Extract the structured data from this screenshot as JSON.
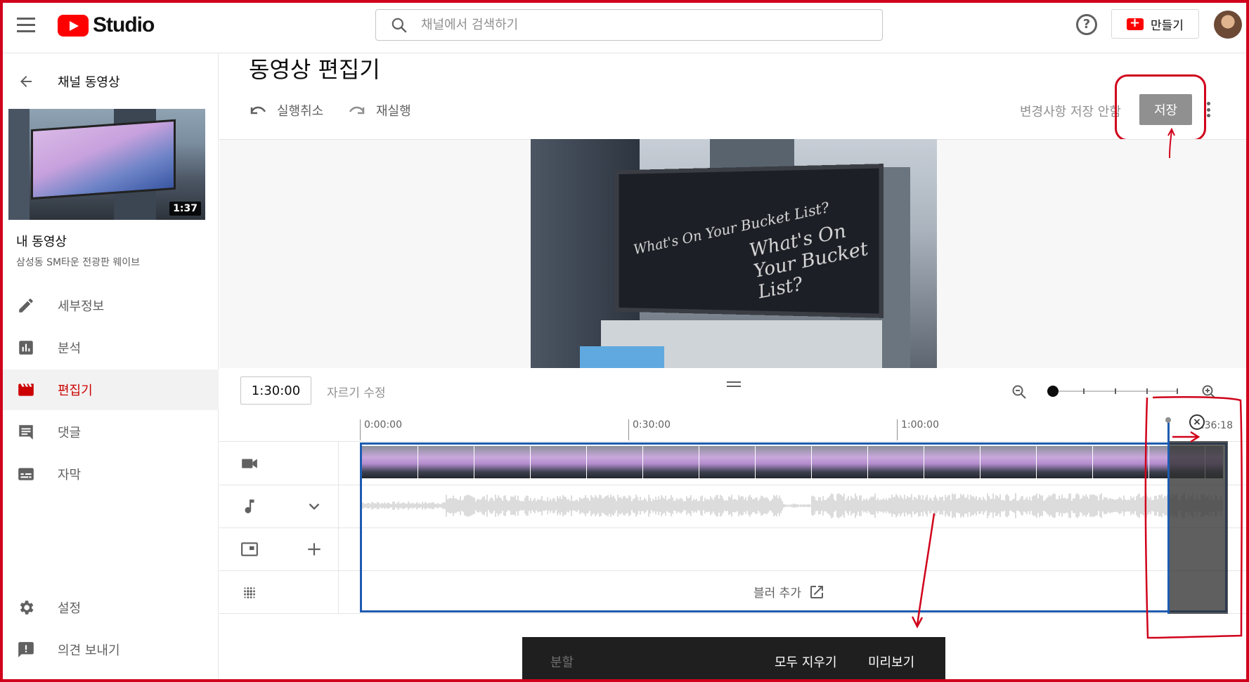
{
  "topbar": {
    "logo_text": "Studio",
    "search_placeholder": "채널에서 검색하기",
    "help_symbol": "?",
    "create_label": "만들기"
  },
  "sidebar": {
    "back_label": "채널 동영상",
    "thumbnail_duration": "1:37",
    "my_video_label": "내 동영상",
    "video_title": "삼성동 SM타운 전광판 웨이브",
    "items": [
      {
        "label": "세부정보",
        "icon": "pencil-icon"
      },
      {
        "label": "분석",
        "icon": "analytics-icon"
      },
      {
        "label": "편집기",
        "icon": "clapperboard-icon",
        "active": true
      },
      {
        "label": "댓글",
        "icon": "comment-icon"
      },
      {
        "label": "자막",
        "icon": "subtitles-icon"
      }
    ],
    "bottom_items": [
      {
        "label": "설정",
        "icon": "gear-icon"
      },
      {
        "label": "의견 보내기",
        "icon": "feedback-icon"
      }
    ]
  },
  "editor": {
    "title": "동영상 편집기",
    "undo_label": "실행취소",
    "redo_label": "재실행",
    "unsaved_label": "변경사항 저장 안함",
    "save_label": "저장",
    "timecode": "1:30:00",
    "trim_label": "자르기 수정",
    "ruler_marks": [
      "0:00:00",
      "0:30:00",
      "1:00:00"
    ],
    "end_time": "1:36:18",
    "blur_label": "블러 추가",
    "video_board_text_1": "What's On Your Bucket List?",
    "video_board_text_2": "What's On Your Bucket List?"
  },
  "bottombar": {
    "split_label": "분할",
    "clear_all_label": "모두 지우기",
    "preview_label": "미리보기"
  },
  "colors": {
    "accent_red": "#cc0000",
    "annotation_red": "#d0021b",
    "timeline_blue": "#1e5bb0",
    "save_disabled": "#909090"
  }
}
